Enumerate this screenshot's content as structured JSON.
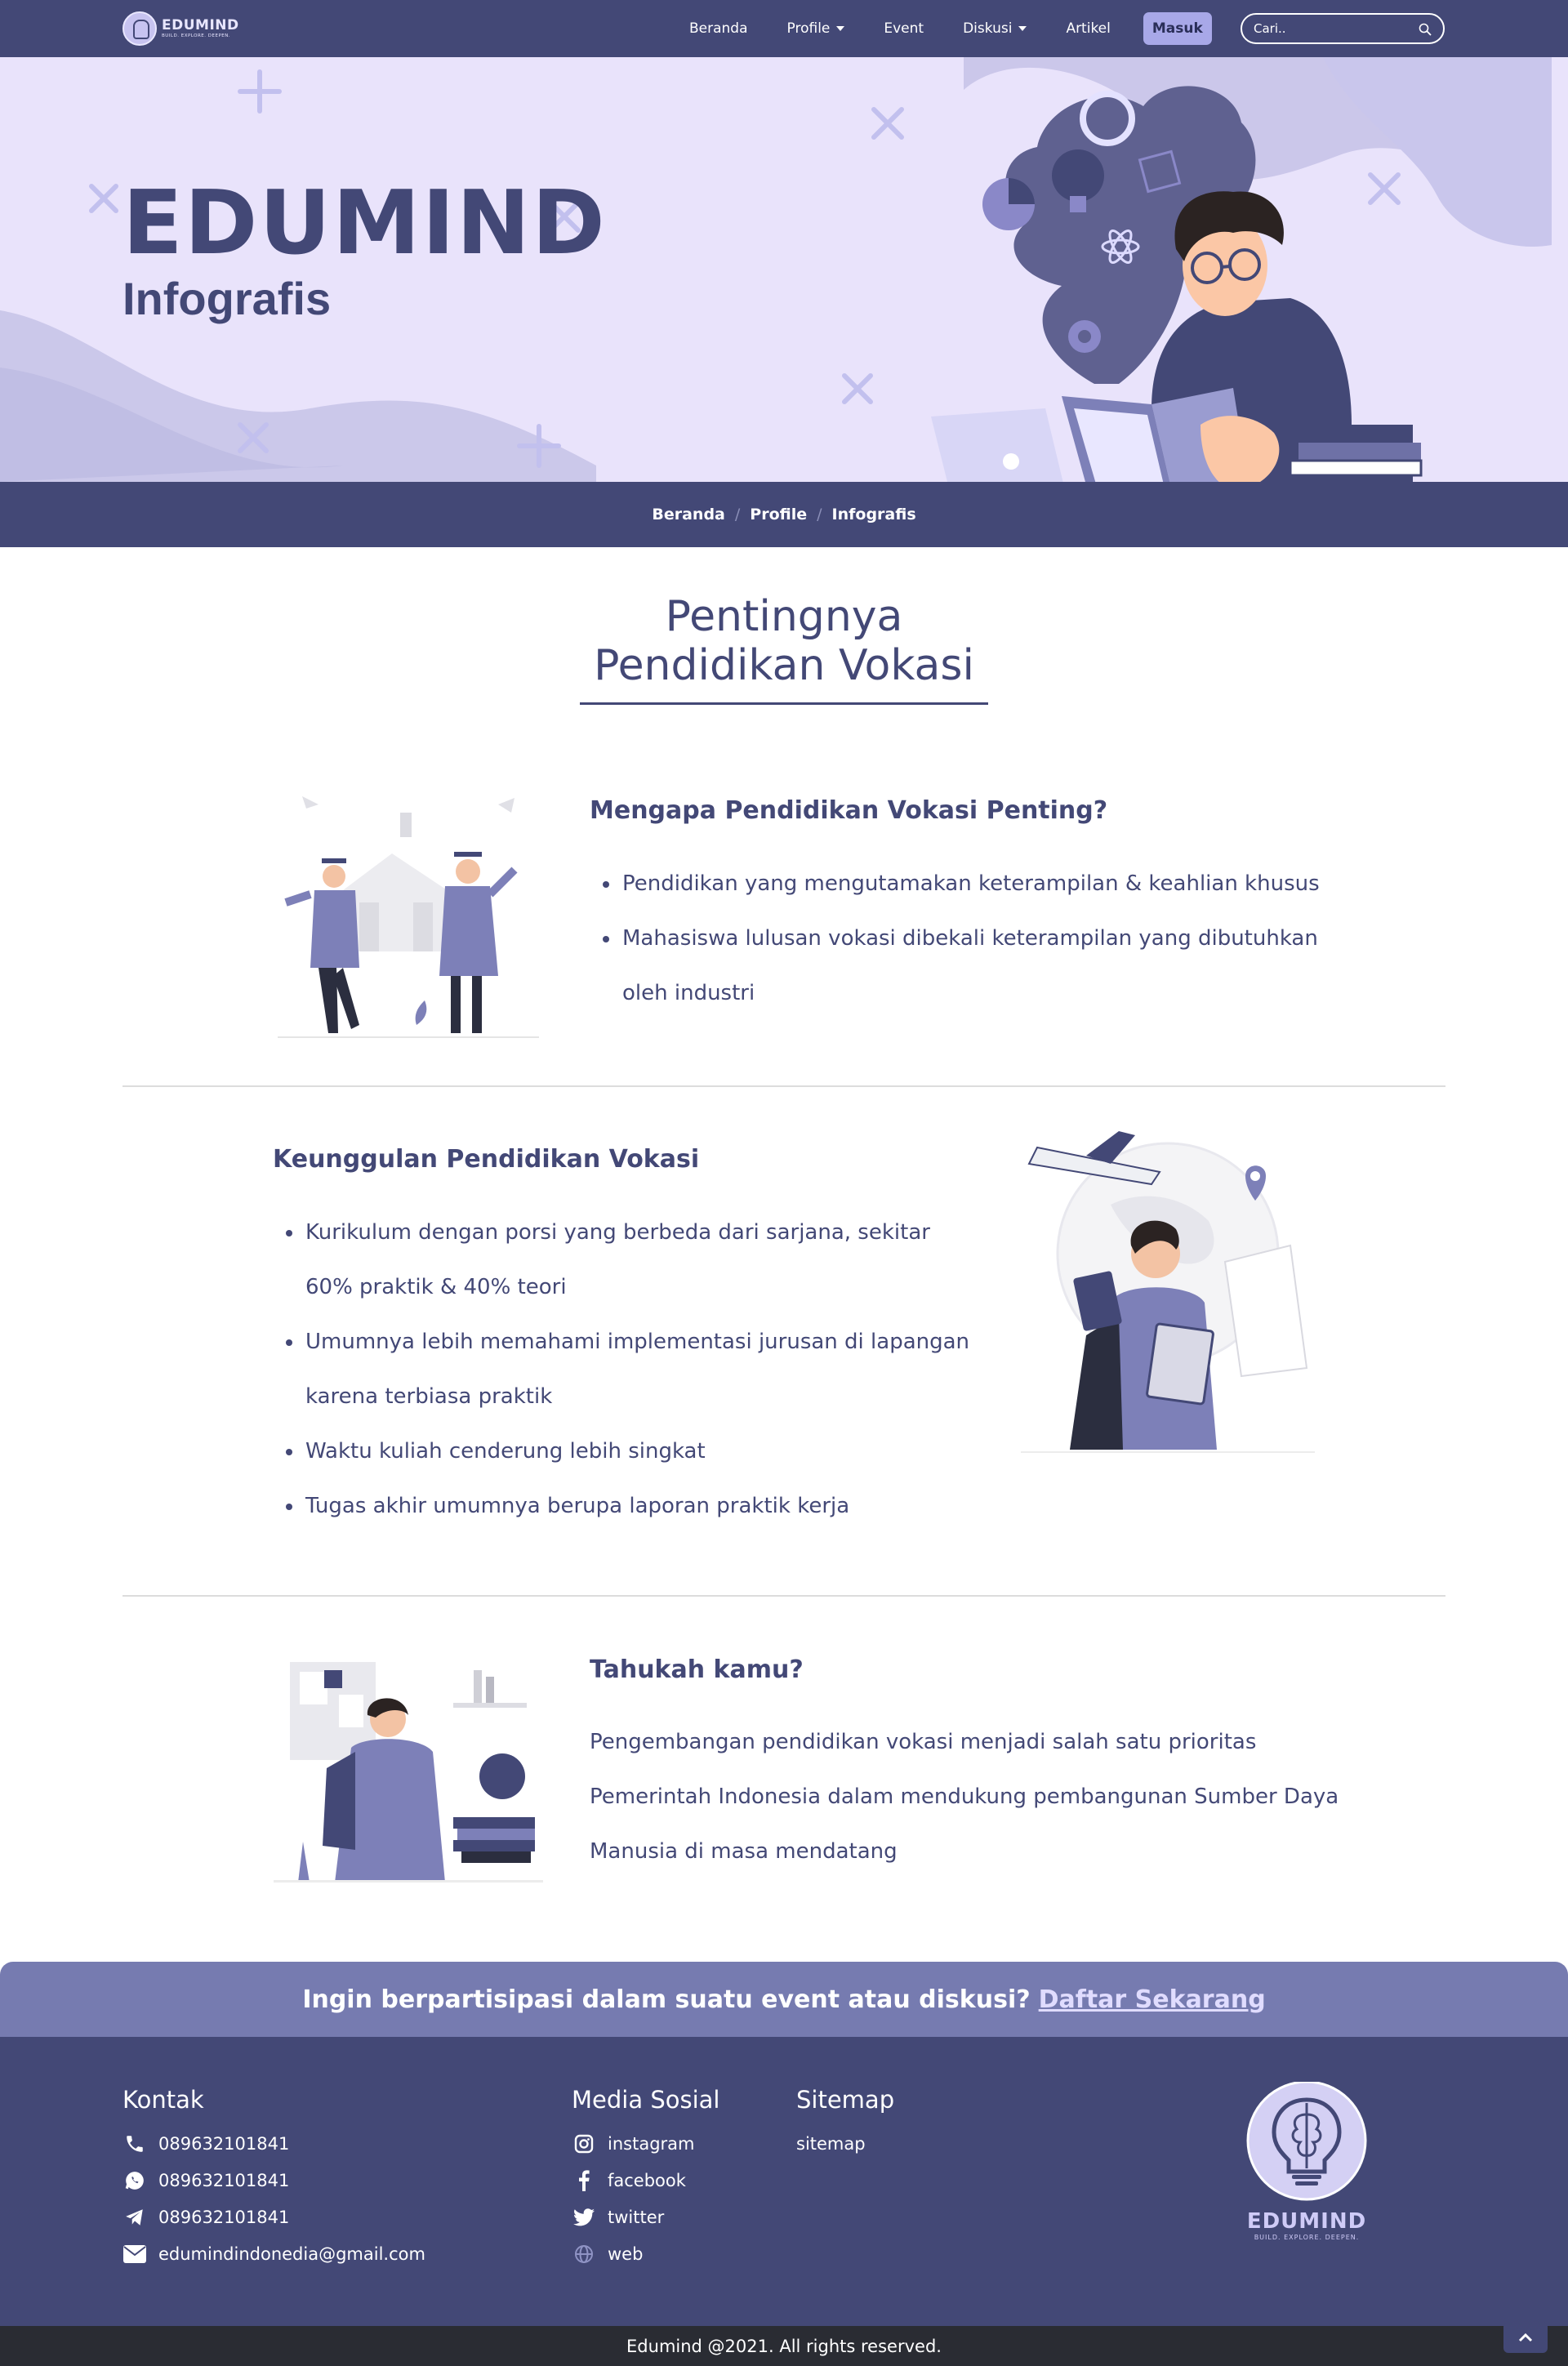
{
  "colors": {
    "primary": "#434876",
    "accent": "#a8a8e8",
    "cta": "#767bb0",
    "hero_bg": "#e9e3fb",
    "copyright_bg": "#2a2c33"
  },
  "navbar": {
    "logo_name": "EDUMIND",
    "logo_tagline": "BUILD. EXPLORE. DEEPEN.",
    "links": [
      "Beranda",
      "Profile",
      "Event",
      "Diskusi",
      "Artikel"
    ],
    "login_label": "Masuk",
    "search_placeholder": "Cari.."
  },
  "hero": {
    "title": "EDUMIND",
    "subtitle": "Infografis"
  },
  "breadcrumb": [
    "Beranda",
    "Profile",
    "Infografis"
  ],
  "main": {
    "title_line1": "Pentingnya",
    "title_line2": "Pendidikan Vokasi",
    "sections": [
      {
        "heading": "Mengapa Pendidikan Vokasi Penting?",
        "bullets": [
          "Pendidikan yang mengutamakan keterampilan & keahlian khusus",
          "Mahasiswa lulusan vokasi dibekali keterampilan yang dibutuhkan oleh industri"
        ]
      },
      {
        "heading": "Keunggulan Pendidikan Vokasi",
        "bullets": [
          "Kurikulum dengan porsi yang berbeda dari sarjana, sekitar 60% praktik & 40% teori",
          "Umumnya lebih memahami implementasi jurusan di lapangan karena terbiasa praktik",
          "Waktu kuliah cenderung lebih singkat",
          "Tugas akhir umumnya berupa laporan praktik kerja"
        ]
      },
      {
        "heading": "Tahukah kamu?",
        "paragraph": "Pengembangan pendidikan vokasi menjadi salah satu prioritas Pemerintah Indonesia dalam mendukung pembangunan Sumber Daya Manusia di masa mendatang"
      }
    ]
  },
  "cta": {
    "text": "Ingin berpartisipasi dalam suatu event atau diskusi?",
    "link": "Daftar Sekarang"
  },
  "footer": {
    "contact_heading": "Kontak",
    "contacts": [
      {
        "icon": "phone-icon",
        "text": "089632101841"
      },
      {
        "icon": "whatsapp-icon",
        "text": "089632101841"
      },
      {
        "icon": "telegram-icon",
        "text": "089632101841"
      },
      {
        "icon": "mail-icon",
        "text": "edumindindonedia@gmail.com"
      }
    ],
    "social_heading": "Media Sosial",
    "socials": [
      {
        "icon": "instagram-icon",
        "text": "instagram"
      },
      {
        "icon": "facebook-icon",
        "text": "facebook"
      },
      {
        "icon": "twitter-icon",
        "text": "twitter"
      },
      {
        "icon": "globe-icon",
        "text": "web"
      }
    ],
    "sitemap_heading": "Sitemap",
    "sitemap_link": "sitemap",
    "logo_name": "EDUMIND",
    "logo_tagline": "BUILD. EXPLORE. DEEPEN."
  },
  "copyright": "Edumind @2021. All rights reserved."
}
